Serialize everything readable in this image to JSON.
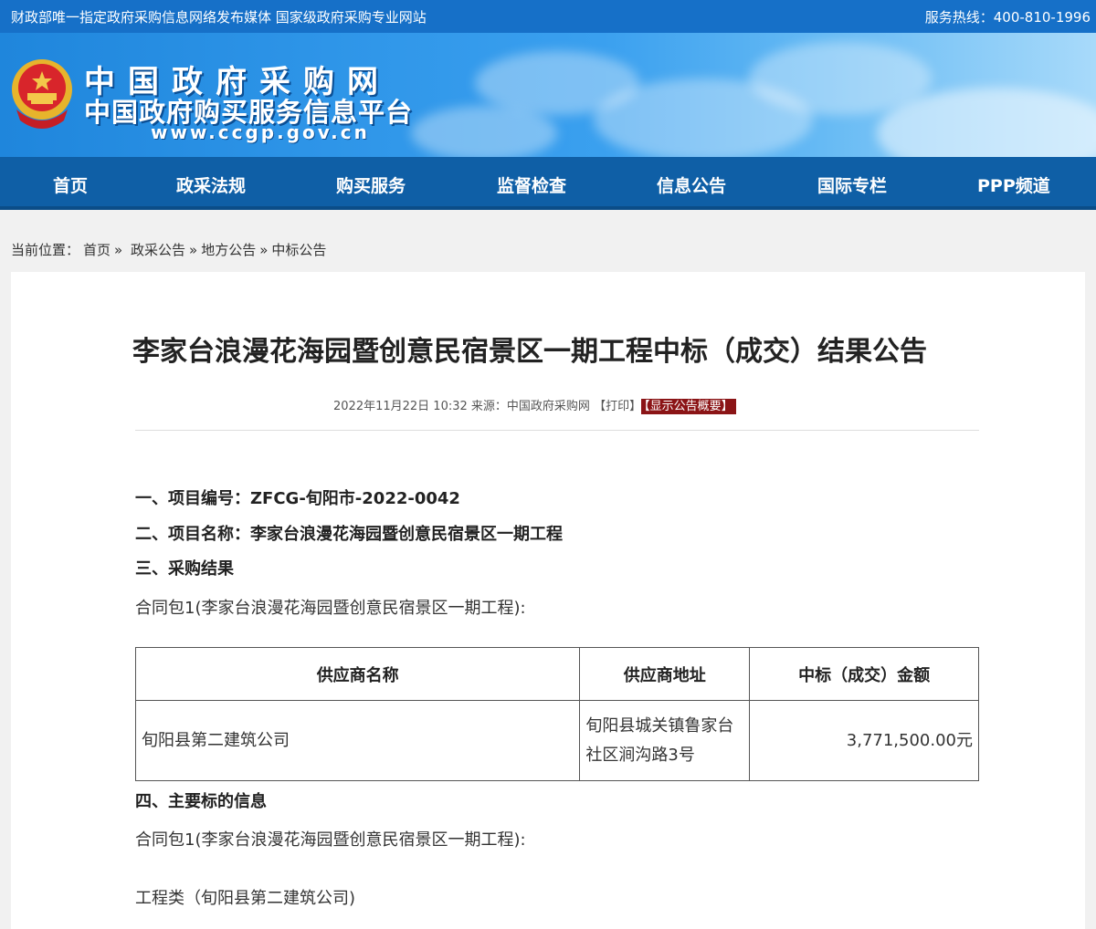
{
  "topbar": {
    "slogan": "财政部唯一指定政府采购信息网络发布媒体 国家级政府采购专业网站",
    "hotline": "服务热线：400-810-1996"
  },
  "brand": {
    "line1": "中国政府采购网",
    "line2": "中国政府购买服务信息平台",
    "url": "www.ccgp.gov.cn"
  },
  "nav": [
    "首页",
    "政采法规",
    "购买服务",
    "监督检查",
    "信息公告",
    "国际专栏",
    "PPP频道"
  ],
  "breadcrumb": {
    "prefix": "当前位置：",
    "items": [
      "首页",
      "»",
      "政采公告",
      "»",
      "地方公告",
      "»",
      "中标公告"
    ]
  },
  "article": {
    "title": "李家台浪漫花海园暨创意民宿景区一期工程中标（成交）结果公告",
    "datetime": "2022年11月22日 10:32",
    "source": "来源：中国政府采购网",
    "print_label": "【打印】",
    "summary_label": "【显示公告概要】",
    "s1": "一、项目编号：ZFCG-旬阳市-2022-0042",
    "s2": "二、项目名称：李家台浪漫花海园暨创意民宿景区一期工程",
    "s3": "三、采购结果",
    "pkg1": "合同包1(李家台浪漫花海园暨创意民宿景区一期工程):",
    "table": {
      "headers": [
        "供应商名称",
        "供应商地址",
        "中标（成交）金额"
      ],
      "rows": [
        {
          "name": "旬阳县第二建筑公司",
          "address": "旬阳县城关镇鲁家台社区涧沟路3号",
          "amount": "3,771,500.00元"
        }
      ]
    },
    "s4": "四、主要标的信息",
    "pkg2": "合同包1(李家台浪漫花海园暨创意民宿景区一期工程):",
    "category": "工程类（旬阳县第二建筑公司)"
  },
  "colors": {
    "topbar": "#1670c8",
    "nav": "#0f5fa6",
    "badge": "#8b1416"
  }
}
